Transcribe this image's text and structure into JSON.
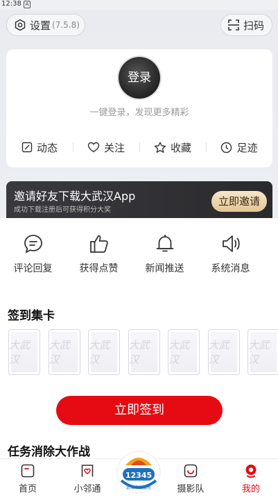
{
  "status_bar": {
    "time": "12:38",
    "notification_badge": "A"
  },
  "header": {
    "settings_label": "设置",
    "version": "(7.5.8)",
    "scan_label": "扫码"
  },
  "profile": {
    "login_label": "登录",
    "tagline": "一键登录，发现更多精彩",
    "quick_links": [
      {
        "label": "动态",
        "icon": "edit-icon"
      },
      {
        "label": "关注",
        "icon": "heart-icon"
      },
      {
        "label": "收藏",
        "icon": "star-icon"
      },
      {
        "label": "足迹",
        "icon": "clock-icon"
      }
    ]
  },
  "invite_banner": {
    "title": "邀请好友下载大武汉App",
    "subtitle": "成功下载注册后可获得积分大奖",
    "button": "立即邀请"
  },
  "messages": [
    {
      "label": "评论回复",
      "icon": "comment-icon"
    },
    {
      "label": "获得点赞",
      "icon": "thumbs-up-icon"
    },
    {
      "label": "新闻推送",
      "icon": "bell-icon"
    },
    {
      "label": "系统消息",
      "icon": "speaker-icon"
    }
  ],
  "checkin": {
    "title": "签到集卡",
    "card_text": "大武汉",
    "card_count": 7,
    "button": "立即签到"
  },
  "task_section": {
    "title": "任务消除大作战"
  },
  "tabbar": {
    "tabs": [
      {
        "label": "首页",
        "icon": "home-icon"
      },
      {
        "label": "小邻通",
        "icon": "neighbor-icon"
      },
      {
        "label": "摄影队",
        "icon": "camera-icon"
      },
      {
        "label": "我的",
        "icon": "profile-icon",
        "active": true
      }
    ],
    "center_badge": "12345",
    "center_caption": "武汉市民服务"
  },
  "colors": {
    "accent": "#e60b12",
    "banner_bg": "#2f2f33",
    "gold": "#e9cf9f"
  }
}
